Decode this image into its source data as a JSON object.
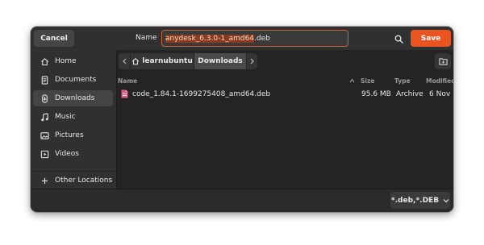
{
  "header": {
    "cancel_label": "Cancel",
    "name_label": "Name",
    "filename_selected": "anydesk_6.3.0-1_amd64",
    "filename_ext": ".deb",
    "search_icon": "search-icon",
    "save_label": "Save"
  },
  "sidebar": {
    "items": [
      {
        "label": "Home",
        "icon": "home-icon"
      },
      {
        "label": "Documents",
        "icon": "document-icon"
      },
      {
        "label": "Downloads",
        "icon": "download-icon"
      },
      {
        "label": "Music",
        "icon": "music-icon"
      },
      {
        "label": "Pictures",
        "icon": "pictures-icon"
      },
      {
        "label": "Videos",
        "icon": "videos-icon"
      },
      {
        "label": "Other Locations",
        "icon": "plus-icon"
      }
    ],
    "active": "Downloads"
  },
  "pathbar": {
    "segments": [
      "learnubuntu",
      "Downloads"
    ],
    "current": "Downloads"
  },
  "columns": [
    "Name",
    "Size",
    "Type",
    "Modified"
  ],
  "files": [
    {
      "name": "code_1.84.1-1699275408_amd64.deb",
      "size": "95.6 MB",
      "type": "Archive",
      "modified": "6 Nov"
    }
  ],
  "footer": {
    "filter_label": "*.deb,*.DEB"
  },
  "colors": {
    "accent": "#e95420",
    "dialog_bg": "#242424",
    "header_bg": "#303030"
  }
}
